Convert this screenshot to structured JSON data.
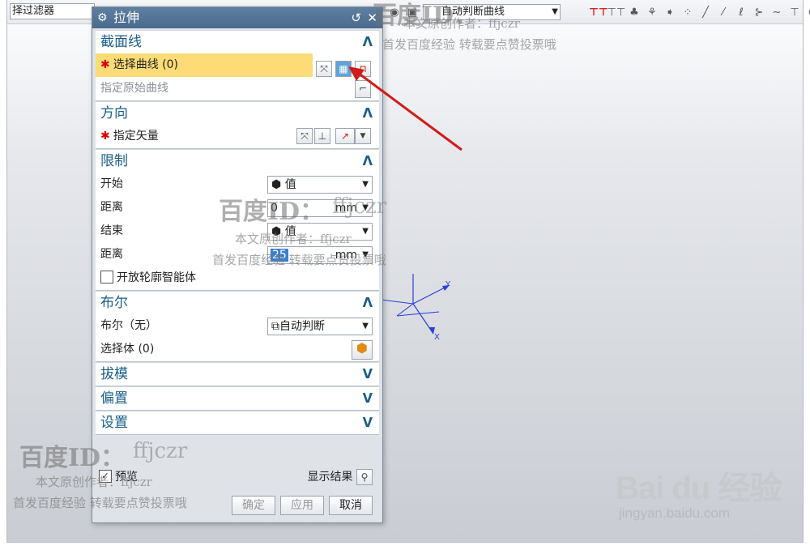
{
  "toolbar": {
    "filter_label": "择过滤器",
    "curve_rule": "自动判断曲线"
  },
  "dialog": {
    "title": "拉伸",
    "sections": {
      "section_curve": {
        "title": "截面线",
        "select_curve": "选择曲线 (0)",
        "origin_curve": "指定原始曲线"
      },
      "direction": {
        "title": "方向",
        "vector": "指定矢量"
      },
      "limits": {
        "title": "限制",
        "start_label": "开始",
        "start_value": "值",
        "dist1_label": "距离",
        "dist1_value": "0",
        "end_label": "结束",
        "end_value": "值",
        "dist2_label": "距离",
        "dist2_value": "25",
        "unit": "mm",
        "open_profile": "开放轮廓智能体"
      },
      "boolean": {
        "title": "布尔",
        "bool_label": "布尔（无）",
        "bool_value": "自动判断",
        "select_body": "选择体 (0)"
      },
      "draft": {
        "title": "拔模"
      },
      "offset": {
        "title": "偏置"
      },
      "settings": {
        "title": "设置"
      }
    },
    "preview": "预览",
    "show_result": "显示结果",
    "ok": "确定",
    "apply": "应用",
    "cancel": "取消"
  },
  "axes": {
    "y": "Y",
    "x": "X"
  },
  "watermarks": {
    "brand": "百度ID：",
    "id": "ffjczr",
    "author": "本文原创作者：ffjczr",
    "notice": "首发百度经验 转载要点赞投票哦",
    "logo": "Bai du 经验",
    "url": "jingyan.baidu.com"
  }
}
